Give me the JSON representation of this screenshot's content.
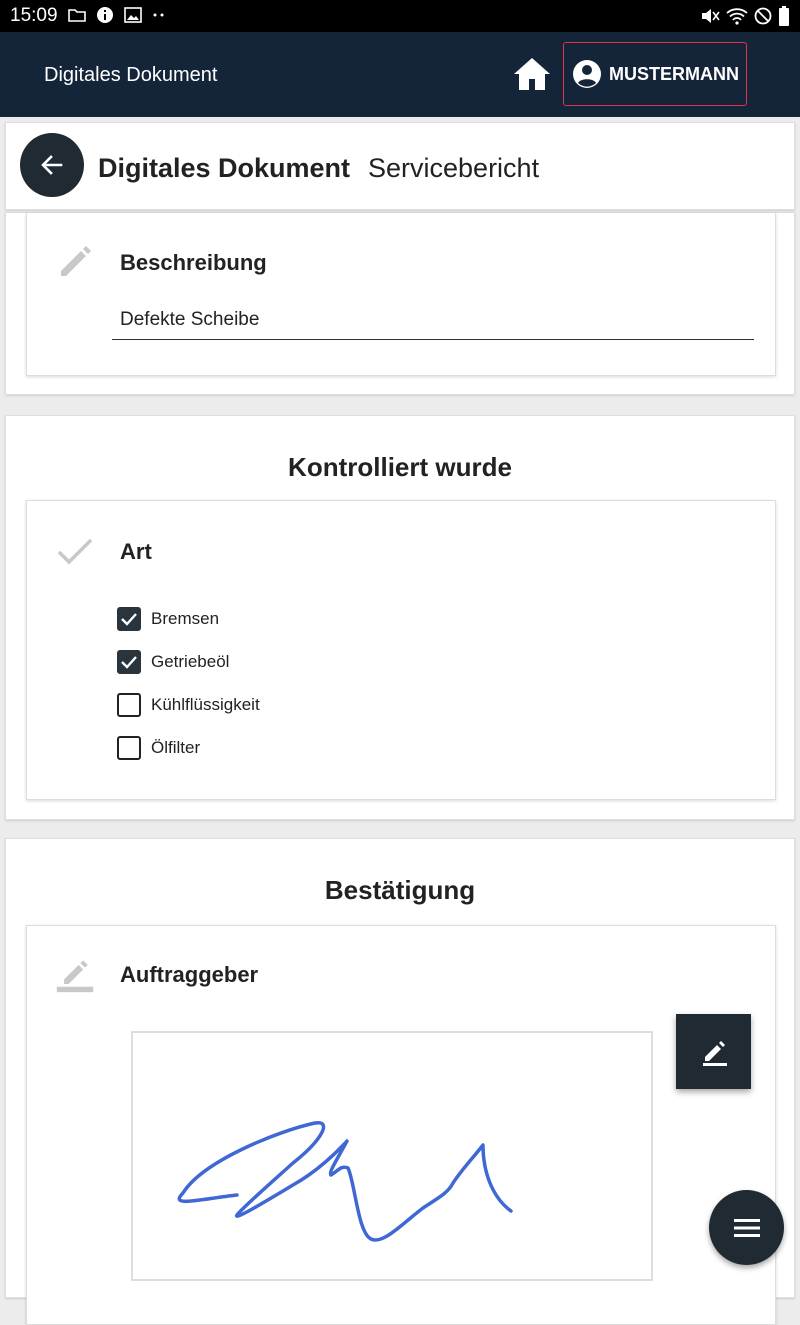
{
  "status_bar": {
    "time": "15:09"
  },
  "app_bar": {
    "title": "Digitales Dokument",
    "user_label": "MUSTERMANN"
  },
  "page_header": {
    "title": "Digitales Dokument",
    "subtitle": "Servicebericht"
  },
  "beschreibung": {
    "label": "Beschreibung",
    "value": "Defekte Scheibe"
  },
  "kontrolliert": {
    "section_title": "Kontrolliert wurde",
    "card_title": "Art",
    "options": [
      {
        "label": "Bremsen",
        "checked": true
      },
      {
        "label": "Getriebeöl",
        "checked": true
      },
      {
        "label": "Kühlflüssigkeit",
        "checked": false
      },
      {
        "label": "Ölfilter",
        "checked": false
      }
    ]
  },
  "bestaetigung": {
    "section_title": "Bestätigung",
    "card_title": "Auftraggeber"
  },
  "colors": {
    "app_bar": "#14253a",
    "dark_button": "#1f2a33",
    "user_border": "#e0344a",
    "signature": "#3f68d4"
  }
}
